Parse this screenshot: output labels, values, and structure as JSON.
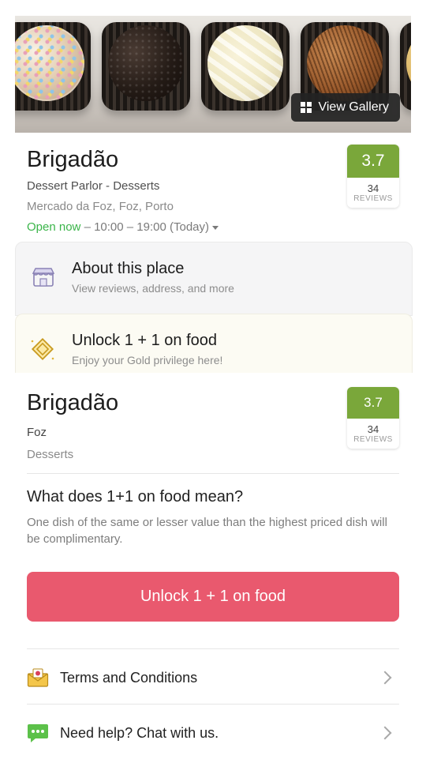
{
  "gallery": {
    "button_label": "View Gallery"
  },
  "restaurant": {
    "name": "Brigadão",
    "type": "Dessert Parlor - Desserts",
    "address": "Mercado da Foz, Foz, Porto",
    "open_status": "Open now",
    "hours": "– 10:00 – 19:00 (Today)",
    "rating": "3.7",
    "review_count": "34",
    "reviews_label": "REVIEWS"
  },
  "cards": {
    "about": {
      "title": "About this place",
      "subtitle": "View reviews, address, and more",
      "icon": "storefront-icon"
    },
    "unlock": {
      "title": "Unlock 1 + 1 on food",
      "subtitle": "Enjoy your Gold privilege here!",
      "icon": "gold-diamond-icon"
    }
  },
  "sheet": {
    "name": "Brigadão",
    "location": "Foz",
    "category": "Desserts",
    "rating": "3.7",
    "review_count": "34",
    "reviews_label": "REVIEWS",
    "question": "What does 1+1 on food mean?",
    "answer": "One dish of the same or lesser value than the highest priced dish will be complimentary.",
    "cta_label": "Unlock 1 + 1 on food",
    "links": [
      {
        "label": "Terms and Conditions",
        "icon": "envelope-icon"
      },
      {
        "label": "Need help? Chat with us.",
        "icon": "chat-icon"
      }
    ]
  },
  "colors": {
    "accent": "#e9596e",
    "rating_green": "#7aa73a",
    "open_green": "#3bb54a"
  }
}
